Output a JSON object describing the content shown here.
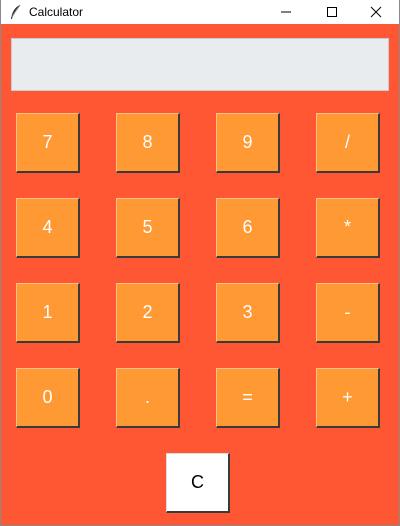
{
  "window": {
    "title": "Calculator"
  },
  "display": {
    "value": ""
  },
  "keys": {
    "row1": [
      "7",
      "8",
      "9",
      "/"
    ],
    "row2": [
      "4",
      "5",
      "6",
      "*"
    ],
    "row3": [
      "1",
      "2",
      "3",
      "-"
    ],
    "row4": [
      "0",
      ".",
      "=",
      "+"
    ],
    "clear": "C"
  },
  "colors": {
    "background": "#ff5733",
    "key": "#ff9933",
    "key_text": "#ffffff",
    "display": "#e9ecef",
    "clear_key": "#ffffff"
  }
}
